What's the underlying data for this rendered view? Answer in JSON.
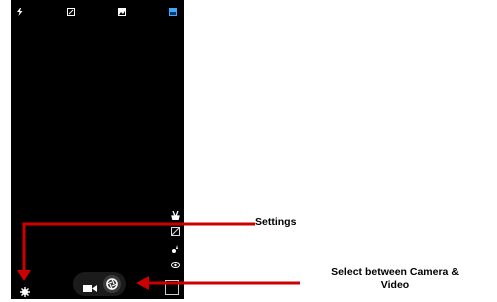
{
  "callouts": {
    "settings": "Settings",
    "select": "Select between Camera &\nVideo",
    "color": "#cc0000"
  },
  "top_icons": [
    "flash-icon",
    "hdr-icon",
    "scene-icon",
    "image-icon"
  ],
  "side_icons": [
    "hand-gesture-icon",
    "image-ratio-icon",
    "exposure-icon",
    "ai-scene-icon"
  ],
  "bottom_controls": [
    "settings-gear-icon",
    "video-mode-icon",
    "camera-shutter-icon",
    "gallery-thumbnail"
  ]
}
